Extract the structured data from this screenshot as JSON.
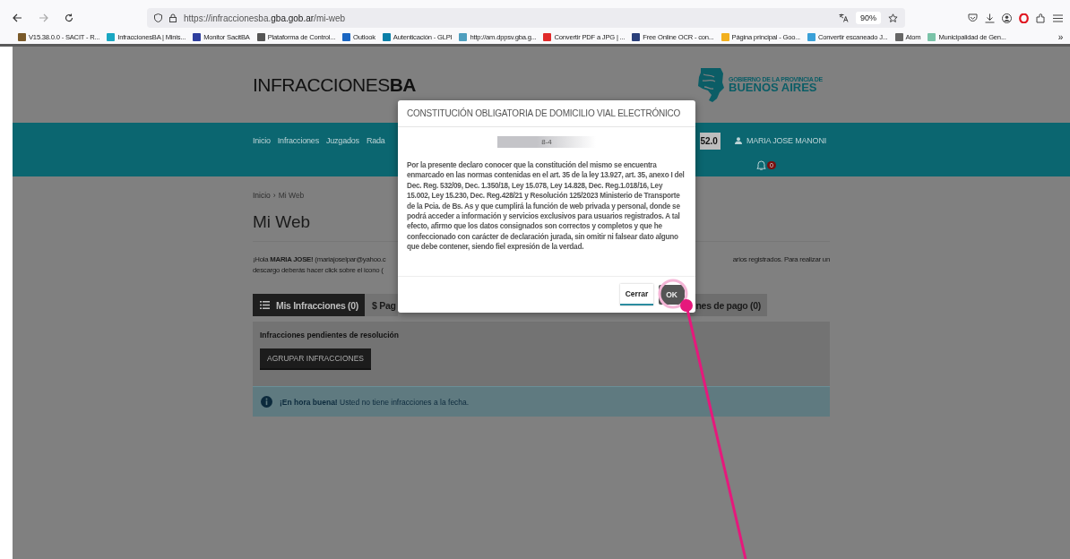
{
  "browser": {
    "url_host_prefix": "https://infraccionesba.",
    "url_host": "gba.gob.ar",
    "url_path": "/mi-web",
    "zoom": "90%",
    "bookmarks": [
      {
        "label": "V15.38.0.0 - SACIT - R...",
        "color": "#7a5a2a"
      },
      {
        "label": "InfraccionesBA | Minis...",
        "color": "#19a7c2"
      },
      {
        "label": "Monitor SacitBA",
        "color": "#2f3f9e"
      },
      {
        "label": "Plataforma de Control...",
        "color": "#555555"
      },
      {
        "label": "Outlook",
        "color": "#1a66c2"
      },
      {
        "label": "Autenticación - GLPI",
        "color": "#0a7fa8"
      },
      {
        "label": "http://am.dppsv.gba.g...",
        "color": "#4f9fbf"
      },
      {
        "label": "Convertir PDF a JPG | ...",
        "color": "#e02a2a"
      },
      {
        "label": "Free Online OCR - con...",
        "color": "#2a3f7a"
      },
      {
        "label": "Página principal - Goo...",
        "color": "#f2b01e"
      },
      {
        "label": "Convertir escaneado J...",
        "color": "#3aa0d8"
      },
      {
        "label": "Atom",
        "color": "#666666"
      },
      {
        "label": "Municipalidad de Gen...",
        "color": "#7ac3a8"
      }
    ],
    "overflow": "»"
  },
  "header": {
    "logo_light": "INFRACCIONES",
    "logo_bold": "BA",
    "gov_small": "GOBIERNO DE LA PROVINCIA DE",
    "gov_big": "BUENOS AIRES"
  },
  "nav": {
    "items": [
      "Inicio",
      "Infracciones",
      "Juzgados",
      "Rada"
    ],
    "version": "52.0",
    "user": "MARIA JOSE MANONI",
    "notifications": "0"
  },
  "breadcrumb": [
    "Inicio",
    "›",
    "Mi Web"
  ],
  "title": "Mi Web",
  "greeting": {
    "left_lines": [
      "¡Hola **MARIA JOSE!** (mariajoselpar@yahoo.c",
      "descargo deberás hacer click sobre el icono ("
    ],
    "right": "arios registrados. Para realizar un"
  },
  "tabs": [
    {
      "label": "Mis Infracciones (0)",
      "selected": true,
      "kind": "list"
    },
    {
      "label": "$ Pag",
      "selected": false,
      "kind": "plain"
    },
    {
      "label": "nes de pago (0)",
      "selected": false,
      "kind": "plain"
    }
  ],
  "panel": {
    "heading": "Infracciones pendientes de resolución",
    "button": "AGRUPAR INFRACCIONES",
    "alert": "**¡En hora buena!** Usted no tiene infracciones a la fecha."
  },
  "modal": {
    "title": "CONSTITUCIÓN OBLIGATORIA DE DOMICILIO VIAL ELECTRÓNICO",
    "field_value": "8-4",
    "body": "Por la presente declaro conocer que la constitución del mismo se encuentra enmarcado en las normas contenidas en el art. 35 de la ley 13.927, art. 35, anexo I del Dec. Reg. 532/09, Dec. 1.350/18, Ley 15.078, Ley 14.828, Dec. Reg.1.018/16, Ley 15.002, Ley 15.230, Dec. Reg.428/21 y Resolución 125/2023 Ministerio de Transporte de la Pcia. de Bs. As y que cumplirá la función de web privada y personal, donde se podrá acceder a información y servicios exclusivos para usuarios registrados. A tal efecto, afirmo que los datos consignados son correctos y completos y que he confeccionado con carácter de declaración jurada, sin omitir ni falsear dato alguno que debe contener, siendo fiel expresión de la verdad.",
    "buttons": [
      {
        "label": "Cerrar",
        "kind": "secondary"
      },
      {
        "label": "OK",
        "kind": "primary"
      }
    ]
  }
}
